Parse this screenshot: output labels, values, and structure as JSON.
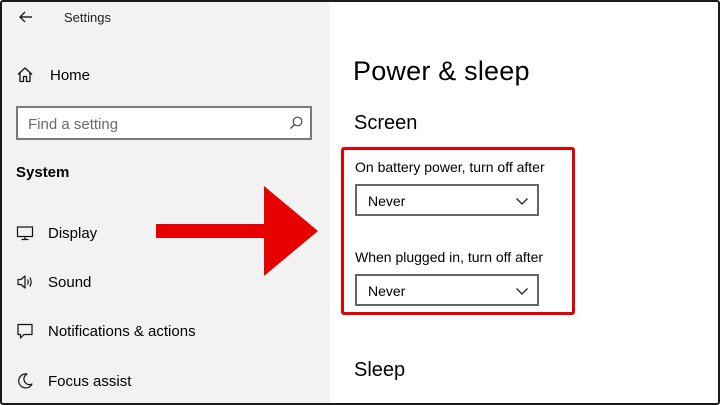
{
  "window": {
    "title": "Settings"
  },
  "sidebar": {
    "home_label": "Home",
    "search": {
      "placeholder": "Find a setting"
    },
    "section_heading": "System",
    "items": [
      {
        "label": "Display",
        "icon": "monitor-icon"
      },
      {
        "label": "Sound",
        "icon": "speaker-icon"
      },
      {
        "label": "Notifications & actions",
        "icon": "message-icon"
      },
      {
        "label": "Focus assist",
        "icon": "moon-icon"
      }
    ]
  },
  "main": {
    "page_title": "Power & sleep",
    "screen": {
      "heading": "Screen",
      "battery_label": "On battery power, turn off after",
      "battery_value": "Never",
      "plugged_label": "When plugged in, turn off after",
      "plugged_value": "Never"
    },
    "sleep": {
      "heading": "Sleep"
    }
  },
  "annotation": {
    "highlight_color": "#e60000",
    "arrow_color": "#e60000"
  },
  "colors": {
    "sidebar_bg": "#f2f2f2",
    "main_bg": "#ffffff",
    "input_border": "#7a7a7a"
  }
}
